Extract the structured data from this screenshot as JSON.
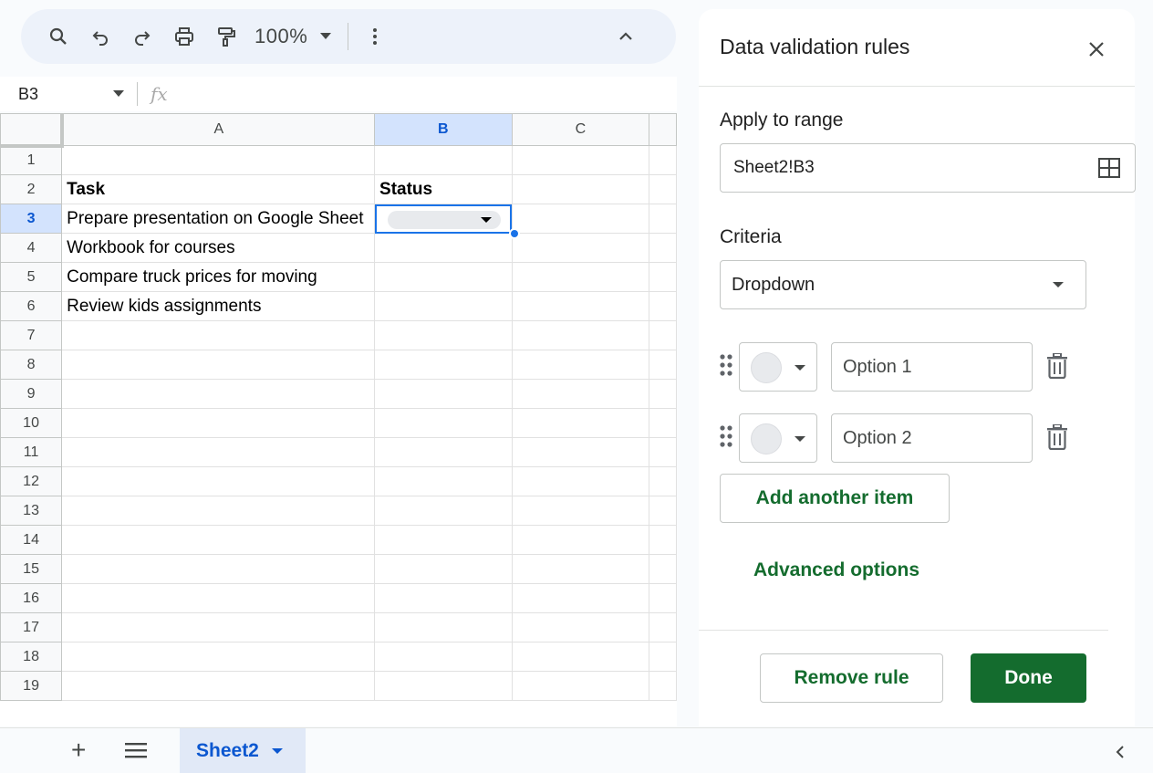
{
  "toolbar": {
    "zoom": "100%",
    "icons": [
      "search-icon",
      "undo-icon",
      "redo-icon",
      "print-icon",
      "paint-format-icon",
      "more-vert-icon",
      "collapse-icon"
    ]
  },
  "formula_bar": {
    "name_box": "B3",
    "fx": "fx"
  },
  "grid": {
    "columns": [
      "A",
      "B",
      "C"
    ],
    "selected_column": "B",
    "selected_row": "3",
    "rows": [
      {
        "num": "1",
        "a": "",
        "b": ""
      },
      {
        "num": "2",
        "a": "Task",
        "b": "Status"
      },
      {
        "num": "3",
        "a": "Prepare presentation on Google Sheet",
        "b": ""
      },
      {
        "num": "4",
        "a": "Workbook for courses",
        "b": ""
      },
      {
        "num": "5",
        "a": "Compare truck prices for moving",
        "b": ""
      },
      {
        "num": "6",
        "a": "Review kids assignments",
        "b": ""
      },
      {
        "num": "7"
      },
      {
        "num": "8"
      },
      {
        "num": "9"
      },
      {
        "num": "10"
      },
      {
        "num": "11"
      },
      {
        "num": "12"
      },
      {
        "num": "13"
      },
      {
        "num": "14"
      },
      {
        "num": "15"
      },
      {
        "num": "16"
      },
      {
        "num": "17"
      },
      {
        "num": "18"
      },
      {
        "num": "19"
      }
    ]
  },
  "sheets": {
    "active": "Sheet2"
  },
  "panel": {
    "title": "Data validation rules",
    "apply_label": "Apply to range",
    "range_value": "Sheet2!B3",
    "criteria_label": "Criteria",
    "criteria_value": "Dropdown",
    "options": [
      {
        "placeholder": "Option 1"
      },
      {
        "placeholder": "Option 2"
      }
    ],
    "add_item": "Add another item",
    "advanced": "Advanced options",
    "remove": "Remove rule",
    "done": "Done",
    "colors": {
      "accent": "#146c2e",
      "selection": "#1a73e8"
    }
  }
}
